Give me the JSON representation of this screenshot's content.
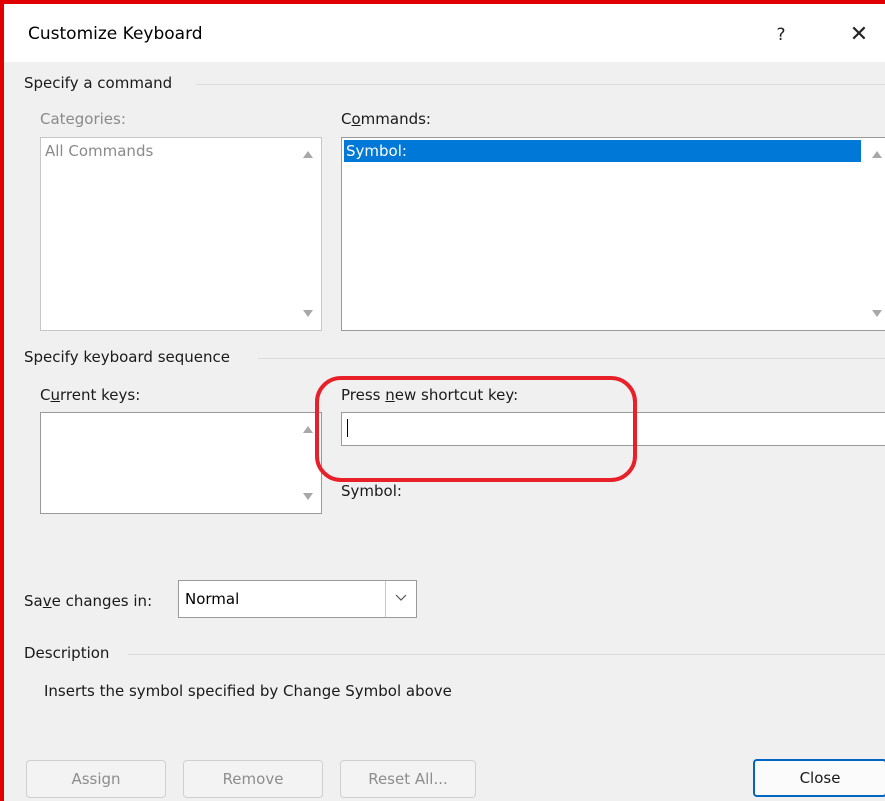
{
  "window": {
    "title": "Customize Keyboard",
    "help_label": "?",
    "close_label": "✕"
  },
  "specify_command": {
    "group_label": "Specify a command",
    "categories": {
      "label": "Categories:",
      "items": [
        "All Commands"
      ]
    },
    "commands": {
      "label_pre": "C",
      "label_u": "o",
      "label_post": "mmands:",
      "items": [
        "Symbol:"
      ],
      "selected": "Symbol:"
    }
  },
  "keyboard_sequence": {
    "group_label": "Specify keyboard sequence",
    "current_keys": {
      "label_pre": "C",
      "label_u": "u",
      "label_post": "rrent keys:"
    },
    "new_shortcut": {
      "label_pre": "Press ",
      "label_u": "n",
      "label_post": "ew shortcut key:",
      "value": ""
    },
    "current_assignment": "Symbol:"
  },
  "save_changes": {
    "label_pre": "Sa",
    "label_u": "v",
    "label_post": "e changes in:",
    "value": "Normal"
  },
  "description": {
    "group_label": "Description",
    "text": "Inserts the symbol specified by Change Symbol above"
  },
  "buttons": {
    "assign": "Assign",
    "remove": "Remove",
    "reset_all": "Reset All...",
    "close": "Close"
  },
  "colors": {
    "annotation_red": "#e8202a",
    "selection_blue": "#0078d7",
    "primary_border": "#0067c0"
  }
}
